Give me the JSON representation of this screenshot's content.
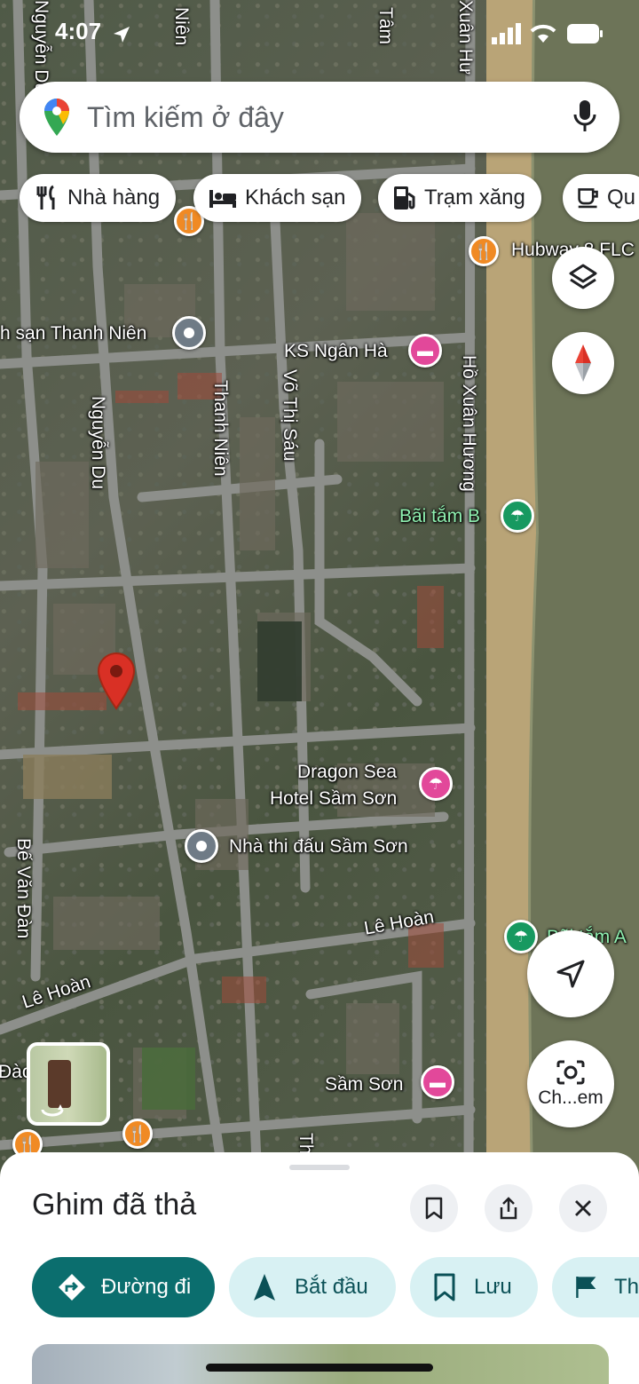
{
  "status_bar": {
    "time": "4:07"
  },
  "search": {
    "placeholder": "Tìm kiếm ở đây",
    "logo_icon": "google-maps-pin-icon",
    "mic_icon": "microphone-icon"
  },
  "chips": [
    {
      "label": "Nhà hàng",
      "icon": "restaurant-icon"
    },
    {
      "label": "Khách sạn",
      "icon": "hotel-icon"
    },
    {
      "label": "Trạm xăng",
      "icon": "gas-station-icon"
    },
    {
      "label": "Qu",
      "icon": "coffee-icon"
    }
  ],
  "map": {
    "streets": {
      "nguyen_du_top": "Nguyễn Du",
      "thanh_nien_top": "Niên",
      "tam": "Tâm",
      "xuan_huong_top": "Xuân Hư",
      "nguyen_du": "Nguyễn Du",
      "thanh_nien": "Thanh Niên",
      "vo_thi_sau": "Võ Thị Sáu",
      "ho_xuan_huong": "Hồ Xuân Hương",
      "be_van_dan": "Bế Văn Đàn",
      "le_hoan_1": "Lê Hoàn",
      "le_hoan_2": "Lê Hoàn",
      "dao": "Đào",
      "th": "Th"
    },
    "places": {
      "thanh_nien": "h sạn Thanh Niên",
      "ks_ngan_ha": "KS Ngân Hà",
      "bai_tam_b": "Bãi tắm B",
      "dragon_sea_1": "Dragon Sea",
      "dragon_sea_2": "Hotel Sầm Sơn",
      "nha_thi_dau": "Nhà thi đấu Sầm Sơn",
      "sam_son": "Sầm Sơn",
      "hubway": "Hubway 8 FLC",
      "bai_tam_a": "Bãi tắm A"
    }
  },
  "map_buttons": {
    "layers_icon": "layers-icon",
    "compass_icon": "compass-icon",
    "navigate_icon": "navigation-arrow-icon",
    "lens_label": "Ch...em"
  },
  "sheet": {
    "title": "Ghim đã thả",
    "actions": [
      {
        "label": "Đường đi",
        "icon": "directions-icon"
      },
      {
        "label": "Bắt đầu",
        "icon": "navigation-start-icon"
      },
      {
        "label": "Lưu",
        "icon": "bookmark-icon"
      },
      {
        "label": "Th",
        "icon": "flag-icon"
      }
    ]
  },
  "colors": {
    "primary": "#0b6e6e",
    "secondary_bg": "#d8f1f3",
    "pin_red": "#d93025",
    "hotel_pink": "#e2489a",
    "restaurant_orange": "#f08a24",
    "beach_green": "#179960"
  }
}
